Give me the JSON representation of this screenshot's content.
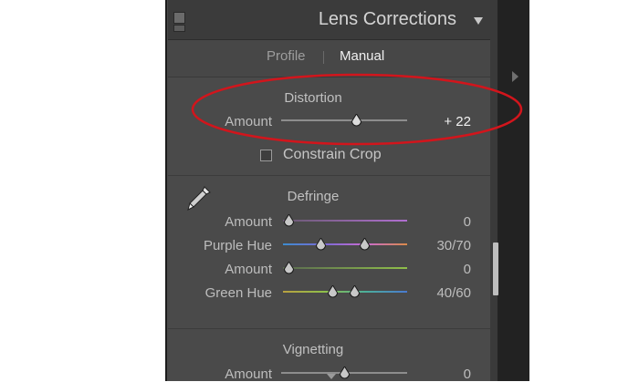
{
  "header": {
    "title": "Lens Corrections"
  },
  "tabs": [
    {
      "label": "Profile",
      "active": false
    },
    {
      "label": "Manual",
      "active": true
    }
  ],
  "distortion": {
    "title": "Distortion",
    "amount_label": "Amount",
    "amount_value": "+ 22",
    "amount": 22,
    "constrain_crop_label": "Constrain Crop",
    "constrain_crop_checked": false
  },
  "defringe": {
    "title": "Defringe",
    "purple_amount_label": "Amount",
    "purple_amount_value": "0",
    "purple_hue_label": "Purple Hue",
    "purple_hue_value": "30/70",
    "green_amount_label": "Amount",
    "green_amount_value": "0",
    "green_hue_label": "Green Hue",
    "green_hue_value": "40/60"
  },
  "vignetting": {
    "title": "Vignetting",
    "amount_label": "Amount",
    "amount_value": "0"
  },
  "colors": {
    "panel_bg": "#4a4a4a",
    "highlight_ellipse": "#d2151c",
    "purple_track": "#9b59b6",
    "green_track": "#7fae3f"
  }
}
